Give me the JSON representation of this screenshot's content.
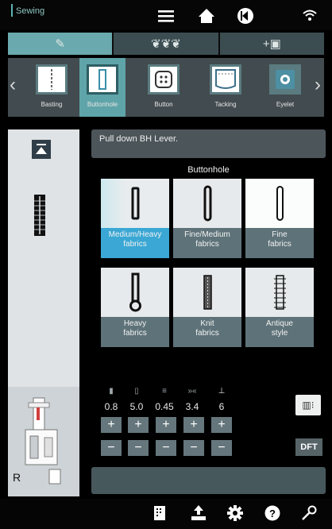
{
  "header": {
    "app_title": "Sewing",
    "icons": [
      "menu-icon",
      "home-icon",
      "exit-icon",
      "wifi-icon"
    ]
  },
  "tabs": [
    {
      "name": "stitch-tab",
      "glyph": "✎",
      "active": true
    },
    {
      "name": "decorative-tab",
      "glyph": "❦❦❦",
      "active": false
    },
    {
      "name": "program-tab",
      "glyph": "+▣",
      "active": false
    }
  ],
  "categories": [
    {
      "label": "Basting",
      "active": false
    },
    {
      "label": "Buttonhole",
      "active": true
    },
    {
      "label": "Button",
      "active": false
    },
    {
      "label": "Tacking",
      "active": false
    },
    {
      "label": "Eyelet",
      "active": false
    }
  ],
  "message": "Pull down BH Lever.",
  "section_title": "Buttonhole",
  "tiles": [
    {
      "line1": "Medium/Heavy",
      "line2": "fabrics",
      "selected": true
    },
    {
      "line1": "Fine/Medium",
      "line2": "fabrics",
      "selected": false
    },
    {
      "line1": "Fine",
      "line2": "fabrics",
      "selected": false
    },
    {
      "line1": "Heavy",
      "line2": "fabrics",
      "selected": false
    },
    {
      "line1": "Knit",
      "line2": "fabrics",
      "selected": false
    },
    {
      "line1": "Antique",
      "line2": "style",
      "selected": false
    }
  ],
  "params": [
    {
      "icon": "stitch-width-icon",
      "value": "0.8"
    },
    {
      "icon": "stitch-length-icon",
      "value": "5.0"
    },
    {
      "icon": "density-icon",
      "value": "0.45"
    },
    {
      "icon": "tension-icon",
      "value": "3.4"
    },
    {
      "icon": "foot-pressure-icon",
      "value": "6"
    }
  ],
  "plus": "+",
  "minus": "−",
  "dft_label": "DFT",
  "side_label": "R",
  "colors": {
    "accent": "#5fa4a8",
    "selected_tile": "#3aa7d4",
    "panel": "#424b4f"
  }
}
